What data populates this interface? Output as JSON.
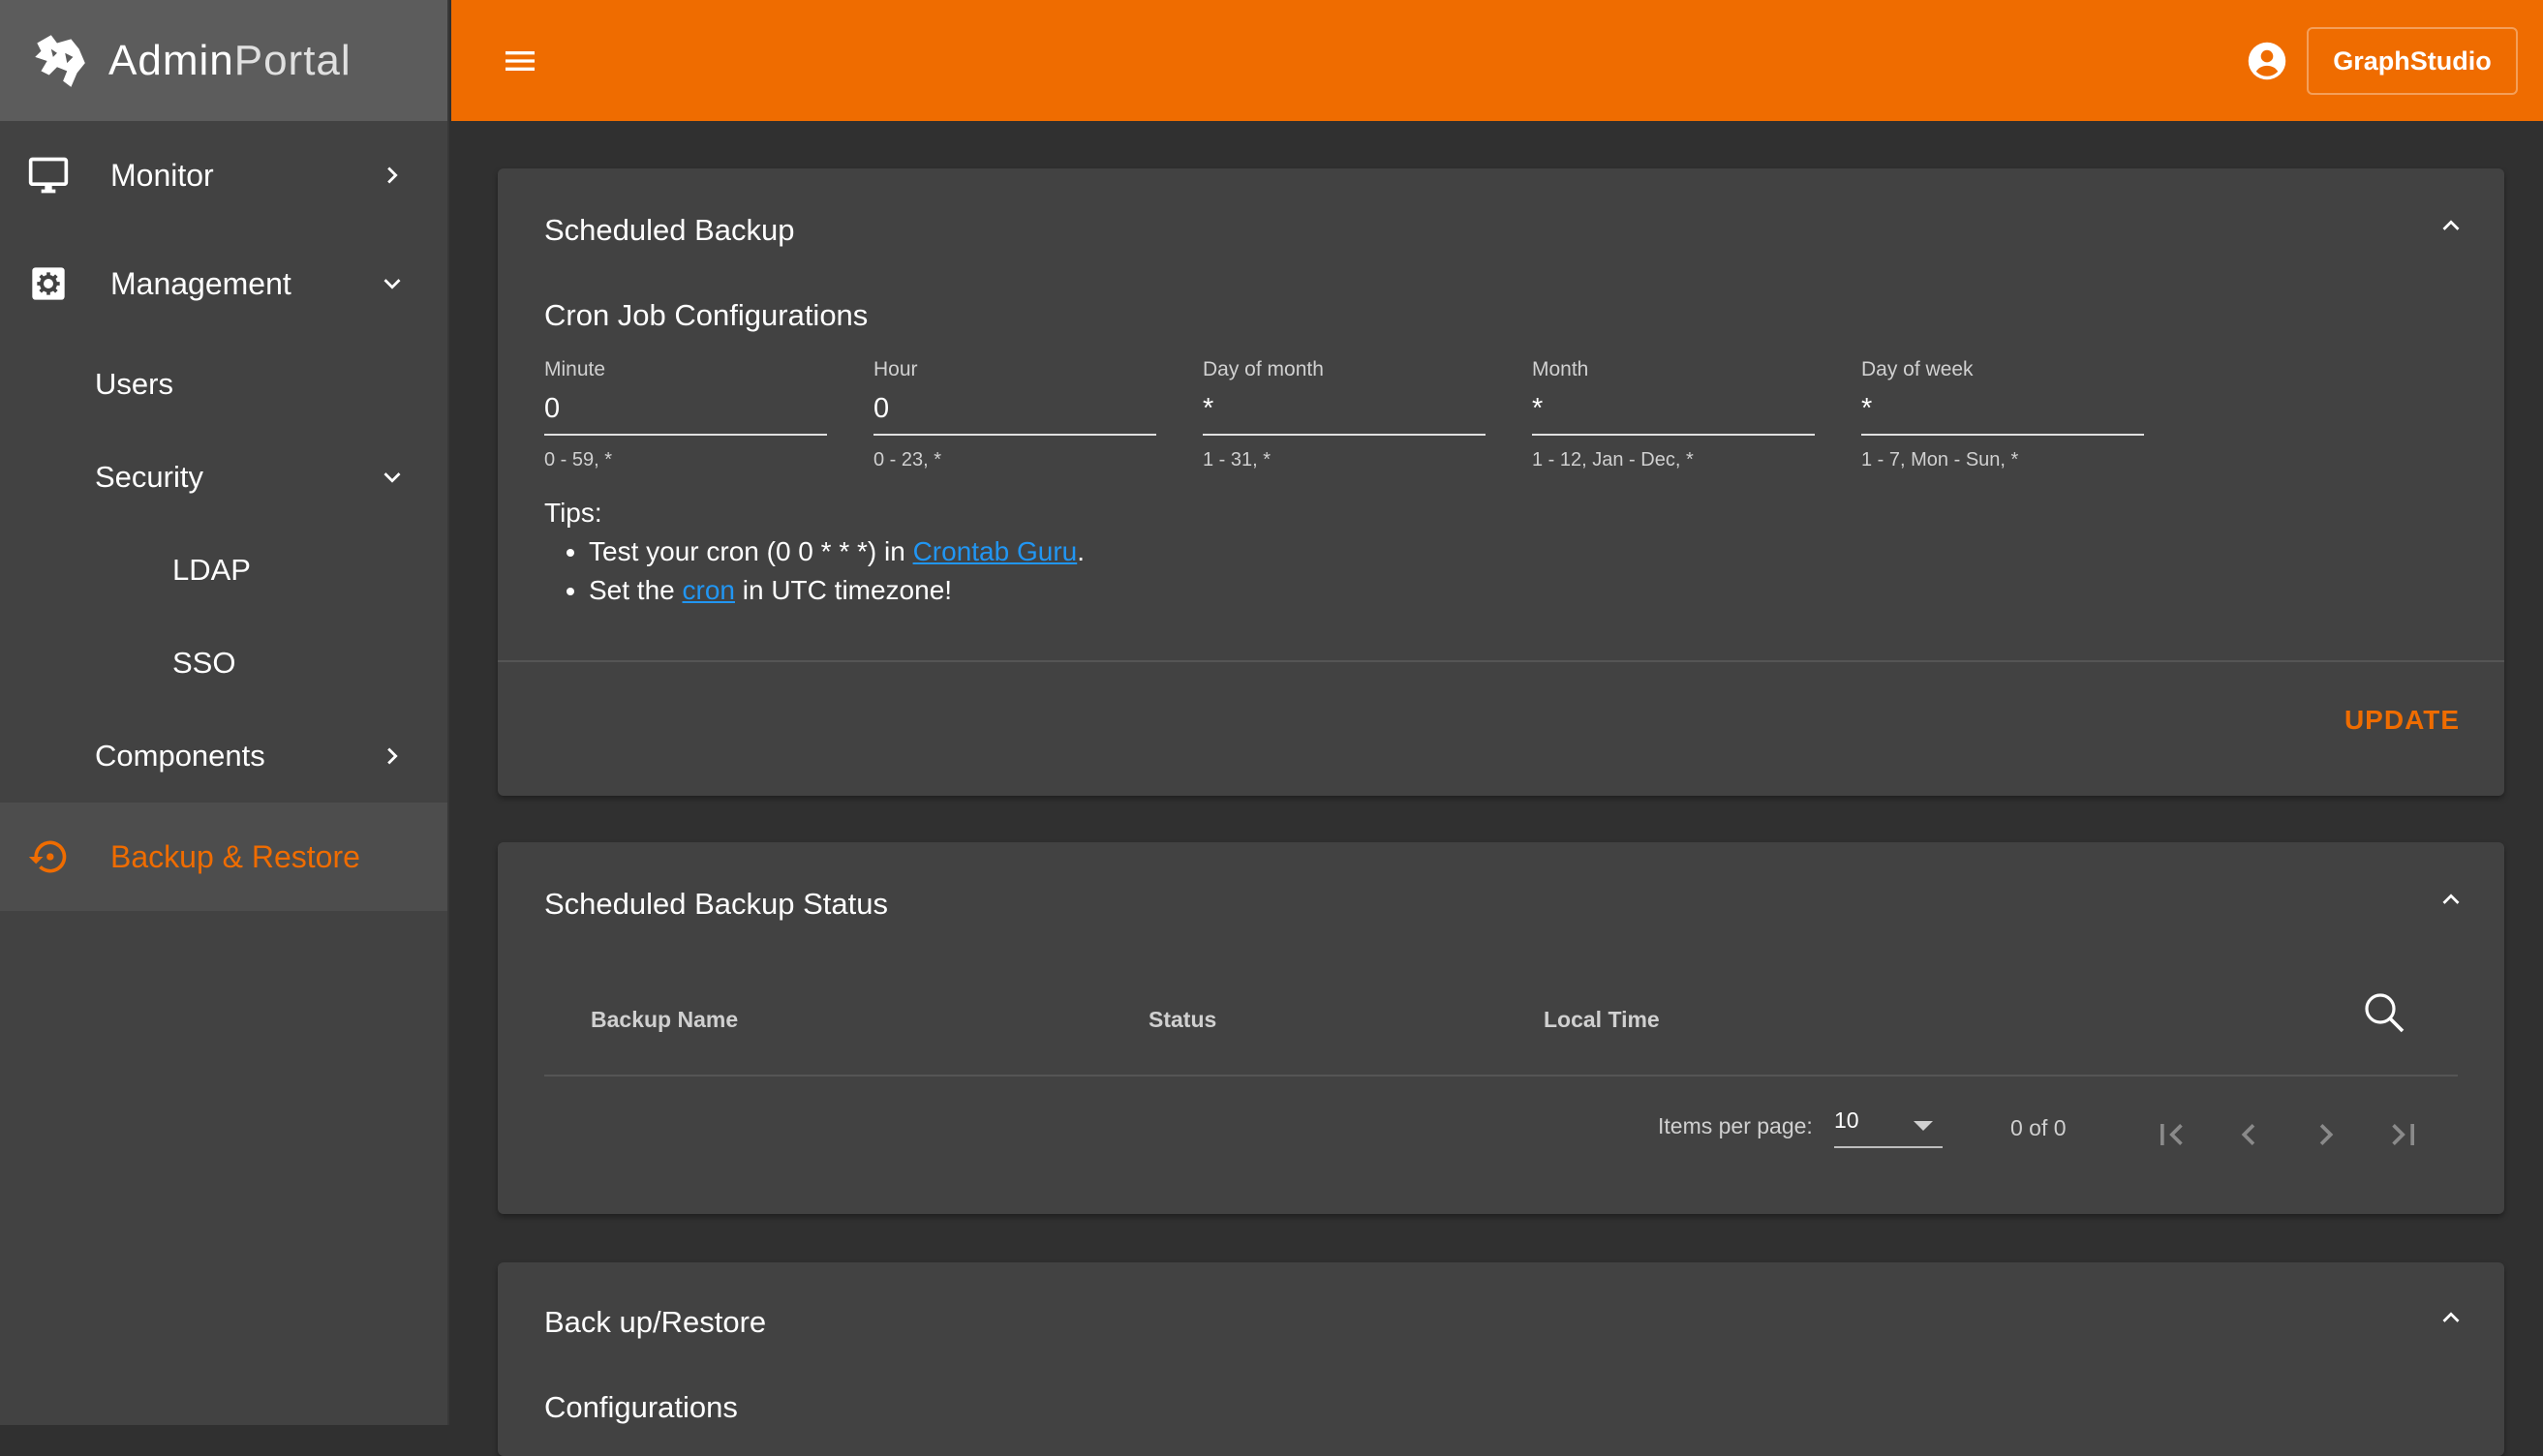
{
  "brand": {
    "name_bold": "Admin",
    "name_thin": "Portal"
  },
  "topbar": {
    "graph_button": "GraphStudio"
  },
  "sidebar": {
    "items": [
      {
        "label": "Monitor"
      },
      {
        "label": "Management"
      },
      {
        "label": "Users"
      },
      {
        "label": "Security"
      },
      {
        "label": "LDAP"
      },
      {
        "label": "SSO"
      },
      {
        "label": "Components"
      },
      {
        "label": "Backup & Restore"
      }
    ]
  },
  "scheduled_backup": {
    "title": "Scheduled Backup",
    "subtitle": "Cron Job Configurations",
    "fields": [
      {
        "label": "Minute",
        "value": "0",
        "hint": "0 - 59, *"
      },
      {
        "label": "Hour",
        "value": "0",
        "hint": "0 - 23, *"
      },
      {
        "label": "Day of month",
        "value": "*",
        "hint": "1 - 31, *"
      },
      {
        "label": "Month",
        "value": "*",
        "hint": "1 - 12, Jan - Dec, *"
      },
      {
        "label": "Day of week",
        "value": "*",
        "hint": "1 - 7, Mon - Sun, *"
      }
    ],
    "tips": {
      "heading": "Tips:",
      "tip1_prefix": "Test your cron (0 0 * * *) in ",
      "tip1_link": "Crontab Guru",
      "tip1_suffix": ".",
      "tip2_prefix": "Set the ",
      "tip2_link": "cron",
      "tip2_suffix": " in UTC timezone!"
    },
    "update_label": "UPDATE"
  },
  "backup_status": {
    "title": "Scheduled Backup Status",
    "columns": [
      "Backup Name",
      "Status",
      "Local Time"
    ],
    "items_per_page_label": "Items per page:",
    "items_per_page_value": "10",
    "range_label": "0 of 0"
  },
  "backup_restore": {
    "title": "Back up/Restore",
    "subtitle": "Configurations"
  },
  "colors": {
    "accent": "#ef6c00",
    "link": "#2196f3",
    "background": "#303030",
    "card": "#424242",
    "sidebar": "#424242"
  }
}
